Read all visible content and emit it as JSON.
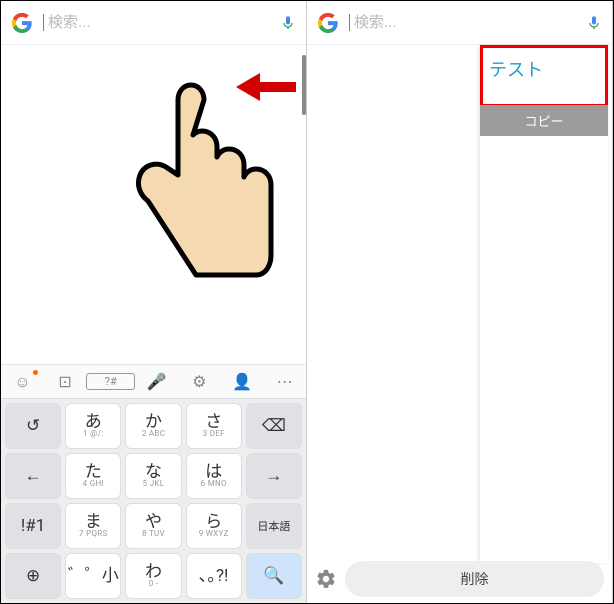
{
  "search": {
    "placeholder": "検索..."
  },
  "keyboard": {
    "rows": [
      [
        {
          "main": "↺",
          "gray": true,
          "name": "undo-key"
        },
        {
          "main": "あ",
          "sub": "1 @/:"
        },
        {
          "main": "か",
          "sub": "2 ABC"
        },
        {
          "main": "さ",
          "sub": "3 DEF"
        },
        {
          "main": "⌫",
          "gray": true,
          "name": "backspace-key"
        }
      ],
      [
        {
          "main": "←",
          "gray": true,
          "name": "left-key"
        },
        {
          "main": "た",
          "sub": "4 GHI"
        },
        {
          "main": "な",
          "sub": "5 JKL"
        },
        {
          "main": "は",
          "sub": "6 MNO"
        },
        {
          "main": "→",
          "gray": true,
          "name": "right-key"
        }
      ],
      [
        {
          "main": "!#1",
          "gray": true,
          "name": "symbols-key"
        },
        {
          "main": "ま",
          "sub": "7 PQRS"
        },
        {
          "main": "や",
          "sub": "8 TUV"
        },
        {
          "main": "ら",
          "sub": "9 WXYZ"
        },
        {
          "main": "日本語",
          "gray": true,
          "small": true,
          "name": "lang-key"
        }
      ],
      [
        {
          "main": "⊕",
          "gray": true,
          "name": "globe-key"
        },
        {
          "main": "゛゜小"
        },
        {
          "main": "わ",
          "sub": "0 -"
        },
        {
          "main": "､｡?!",
          "sub": ""
        },
        {
          "main": "🔍",
          "blue": true,
          "name": "search-key"
        }
      ]
    ]
  },
  "clipboard": {
    "text": "テスト",
    "copy_label": "コピー",
    "delete_label": "削除"
  }
}
